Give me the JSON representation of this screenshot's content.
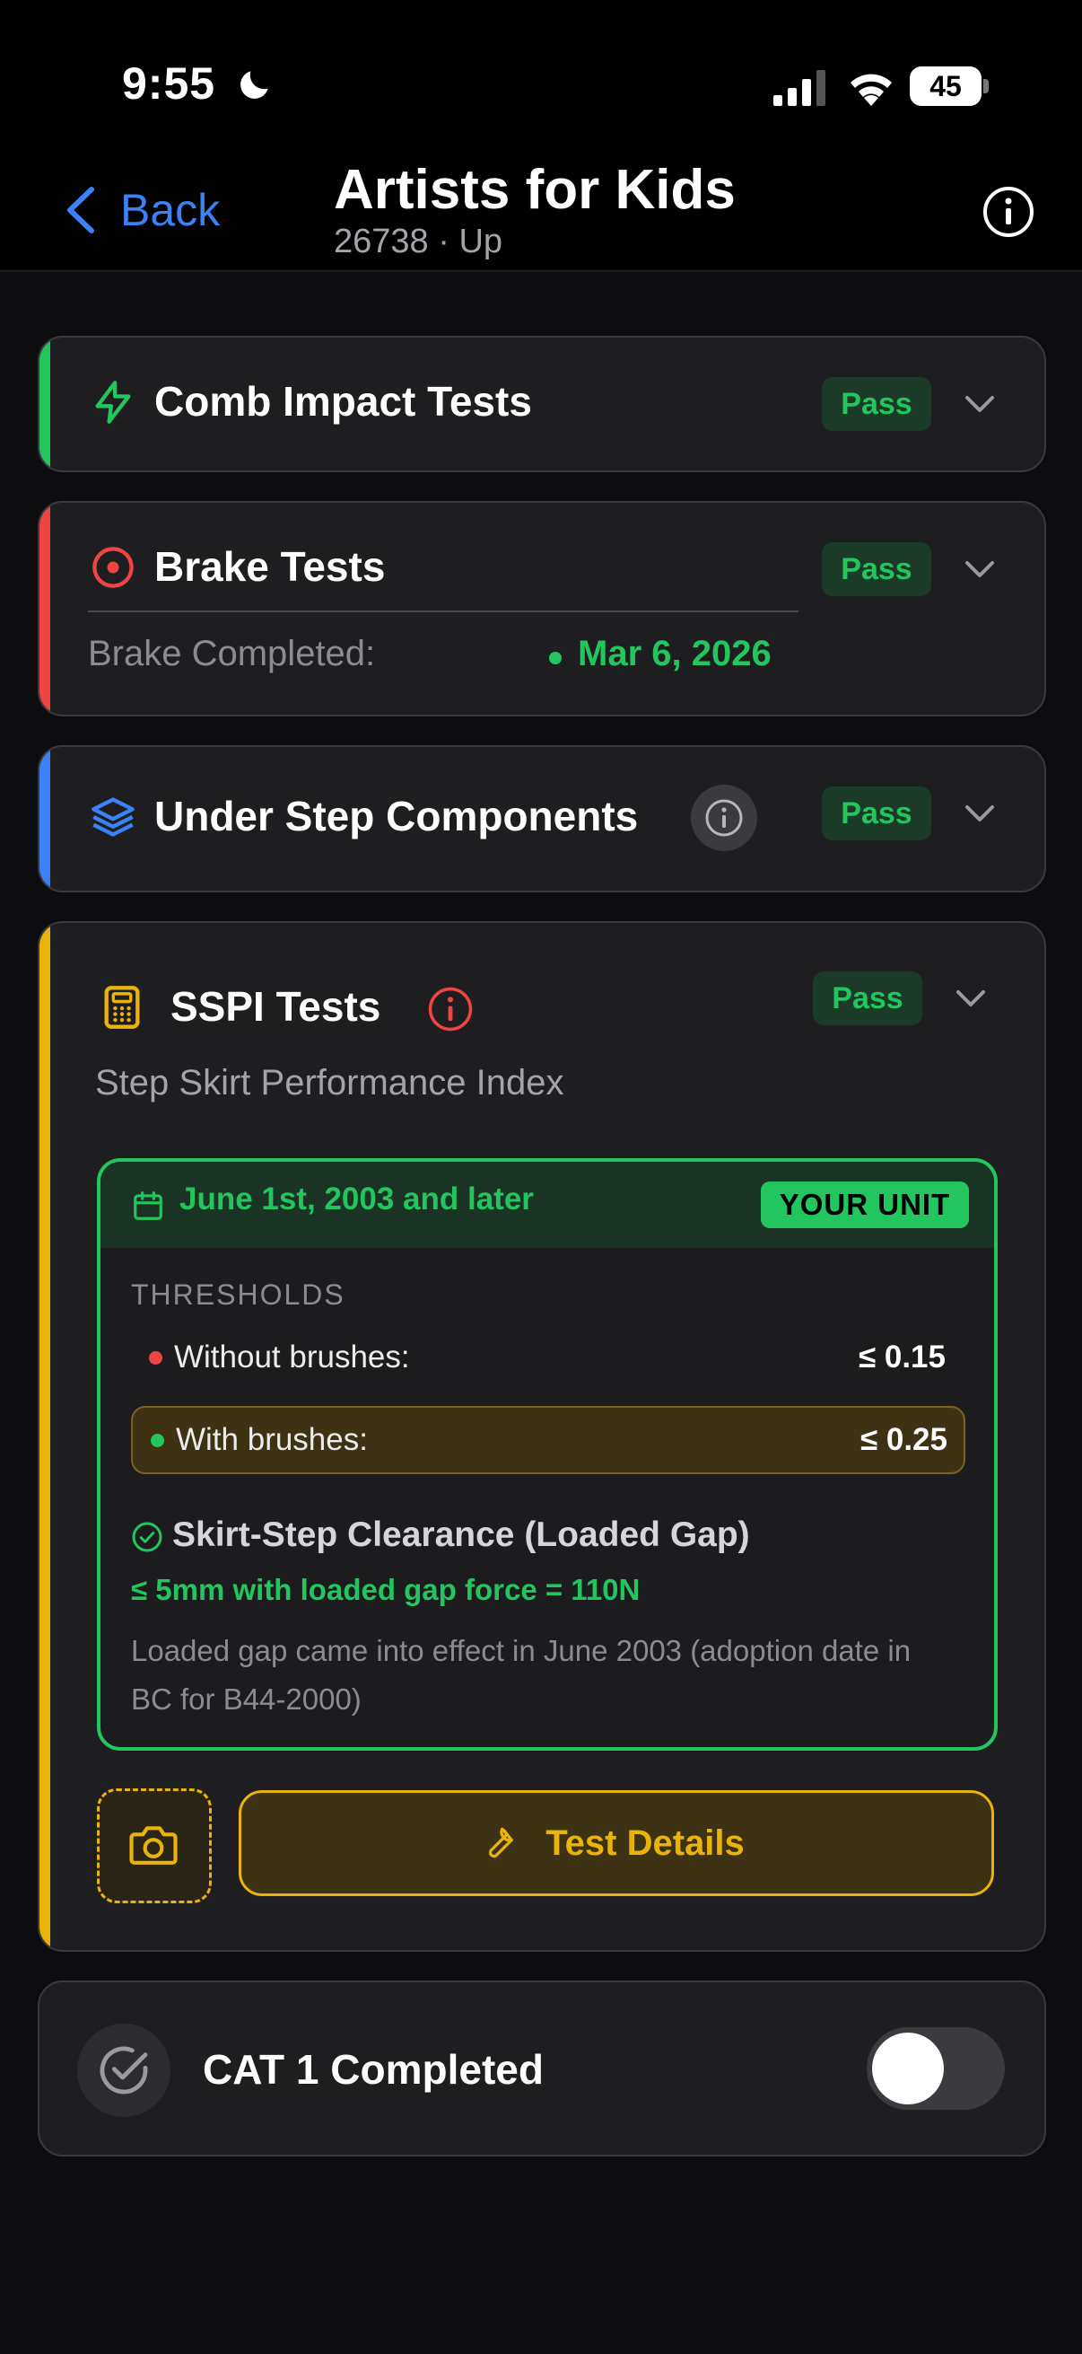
{
  "status_bar": {
    "time": "9:55",
    "battery": "45"
  },
  "nav": {
    "back_label": "Back",
    "title": "Artists for Kids",
    "subtitle": "26738 · Up"
  },
  "colors": {
    "green": "#22c55e",
    "red": "#ef4444",
    "blue": "#3b82f6",
    "yellow": "#eab308",
    "link": "#3b82f6"
  },
  "sections": {
    "comb": {
      "title": "Comb Impact Tests",
      "status": "Pass",
      "icon": "lightning-icon"
    },
    "brake": {
      "title": "Brake Tests",
      "status": "Pass",
      "icon": "target-icon",
      "completed_label": "Brake Completed:",
      "completed_date": "Mar 6, 2026"
    },
    "under_step": {
      "title": "Under Step Components",
      "status": "Pass",
      "icon": "layers-icon"
    },
    "sspi": {
      "title": "SSPI Tests",
      "status": "Pass",
      "icon": "calculator-icon",
      "subtitle": "Step Skirt Performance Index",
      "unit": {
        "date_range": "June 1st, 2003 and later",
        "badge": "YOUR UNIT",
        "thresholds_label": "THRESHOLDS",
        "thresholds": [
          {
            "label": "Without brushes:",
            "value": "≤ 0.15",
            "dot_color": "#ef4444"
          },
          {
            "label": "With brushes:",
            "value": "≤ 0.25",
            "dot_color": "#22c55e"
          }
        ],
        "clearance_title": "Skirt-Step Clearance (Loaded Gap)",
        "clearance_spec": "≤ 5mm with loaded gap force = 110N",
        "clearance_note": "Loaded gap came into effect in June 2003 (adoption date in BC for B44-2000)"
      },
      "details_button": "Test Details"
    },
    "cat1": {
      "label": "CAT 1 Completed",
      "toggle_on": false
    }
  }
}
